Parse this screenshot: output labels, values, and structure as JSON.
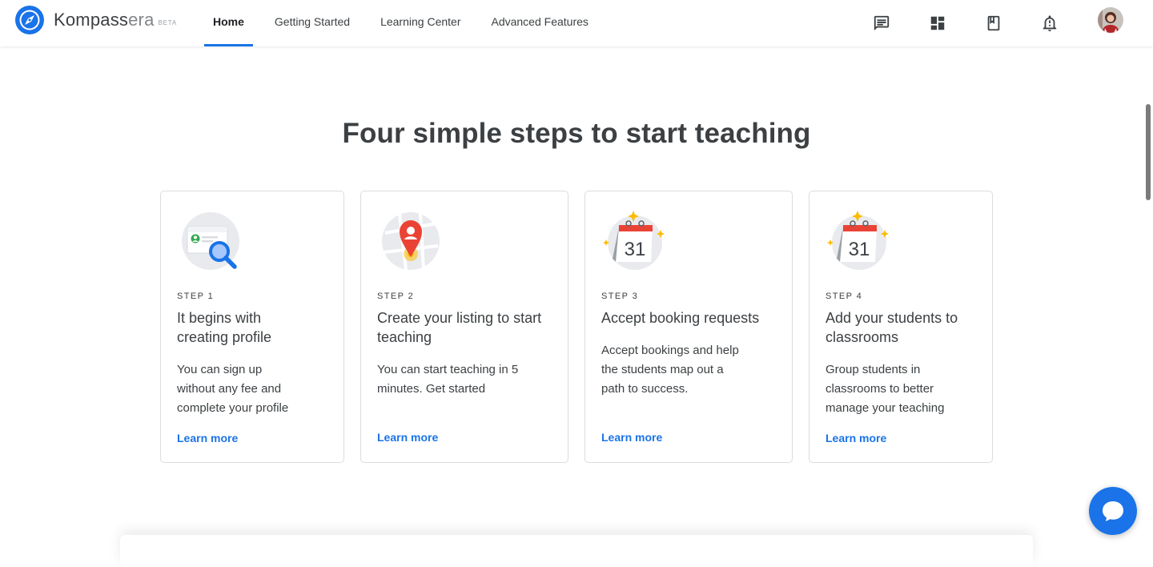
{
  "brand": {
    "name_part1": "Kompass",
    "name_part2": "era",
    "badge": "BETA"
  },
  "nav": {
    "items": [
      "Home",
      "Getting Started",
      "Learning Center",
      "Advanced Features"
    ],
    "active": "Home"
  },
  "header_icons": [
    "chat-icon",
    "dashboard-icon",
    "bookmark-icon",
    "notifications-icon",
    "avatar"
  ],
  "headline": "Four simple steps to start teaching",
  "steps": [
    {
      "step": "STEP 1",
      "title_lines": [
        "It begins with",
        "creating profile"
      ],
      "desc_lines": [
        "You can sign up",
        "without any fee and",
        "complete your profile"
      ],
      "link": "Learn more",
      "icon": "profile-search-icon"
    },
    {
      "step": "STEP 2",
      "title_lines": [
        "Create your listing to start",
        "teaching"
      ],
      "desc_lines": [
        "You can start teaching in 5",
        "minutes. Get started"
      ],
      "link": "Learn more",
      "icon": "map-pin-icon"
    },
    {
      "step": "STEP 3",
      "title_lines": [
        "Accept booking requests"
      ],
      "desc_lines": [
        "Accept bookings and help",
        "the students map out a",
        "path to success."
      ],
      "link": "Learn more",
      "icon": "calendar-icon",
      "calendar_day": "31"
    },
    {
      "step": "STEP 4",
      "title_lines": [
        "Add your students to",
        "classrooms"
      ],
      "desc_lines": [
        "Group students in",
        "classrooms to better",
        "manage your teaching"
      ],
      "link": "Learn more",
      "icon": "calendar-icon",
      "calendar_day": "31"
    }
  ],
  "colors": {
    "accent": "#1a73e8",
    "text": "#3c4043",
    "border": "#dadce0",
    "red": "#ea4335",
    "yellow": "#fbbc04",
    "green": "#34a853"
  }
}
